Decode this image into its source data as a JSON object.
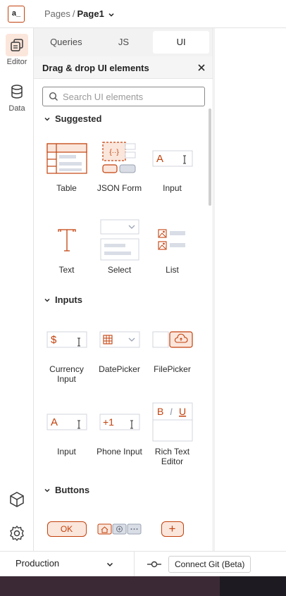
{
  "logo": {
    "text": "a_"
  },
  "breadcrumb": {
    "parent": "Pages",
    "separator": "/",
    "current": "Page1"
  },
  "rail": {
    "items": [
      {
        "label": "Editor",
        "icon": "pages-stack-icon",
        "active": true
      },
      {
        "label": "Data",
        "icon": "database-icon",
        "active": false
      }
    ],
    "bottom_icons": [
      "package-cube-icon",
      "gear-icon"
    ]
  },
  "tabs": [
    {
      "label": "Queries",
      "active": false
    },
    {
      "label": "JS",
      "active": false
    },
    {
      "label": "UI",
      "active": true
    }
  ],
  "panel": {
    "title": "Drag & drop UI elements",
    "search_placeholder": "Search UI elements"
  },
  "sections": {
    "suggested": "Suggested",
    "inputs": "Inputs",
    "buttons": "Buttons"
  },
  "widgets": {
    "suggested": [
      {
        "label": "Table",
        "icon": "table-widget-icon"
      },
      {
        "label": "JSON Form",
        "icon": "json-form-widget-icon"
      },
      {
        "label": "Input",
        "icon": "input-widget-icon"
      },
      {
        "label": "Text",
        "icon": "text-widget-icon"
      },
      {
        "label": "Select",
        "icon": "select-widget-icon"
      },
      {
        "label": "List",
        "icon": "list-widget-icon"
      }
    ],
    "inputs": [
      {
        "label": "Currency Input",
        "icon": "currency-input-widget-icon"
      },
      {
        "label": "DatePicker",
        "icon": "datepicker-widget-icon"
      },
      {
        "label": "FilePicker",
        "icon": "filepicker-widget-icon"
      },
      {
        "label": "Input",
        "icon": "input-widget-icon"
      },
      {
        "label": "Phone Input",
        "icon": "phone-input-widget-icon"
      },
      {
        "label": "Rich Text Editor",
        "icon": "rich-text-editor-widget-icon"
      }
    ],
    "buttons_glyphs": {
      "ok": "OK",
      "plus": "+"
    }
  },
  "icon_text": {
    "input_a": "A",
    "currency": "$",
    "phone": "+1",
    "rte_b": "B",
    "rte_i": "I",
    "rte_u": "U",
    "json": "{··}"
  },
  "bottom": {
    "environment": "Production",
    "git_button": "Connect Git (Beta)"
  },
  "colors": {
    "accent": "#c2410c",
    "accent_light": "#fbe6dc"
  }
}
